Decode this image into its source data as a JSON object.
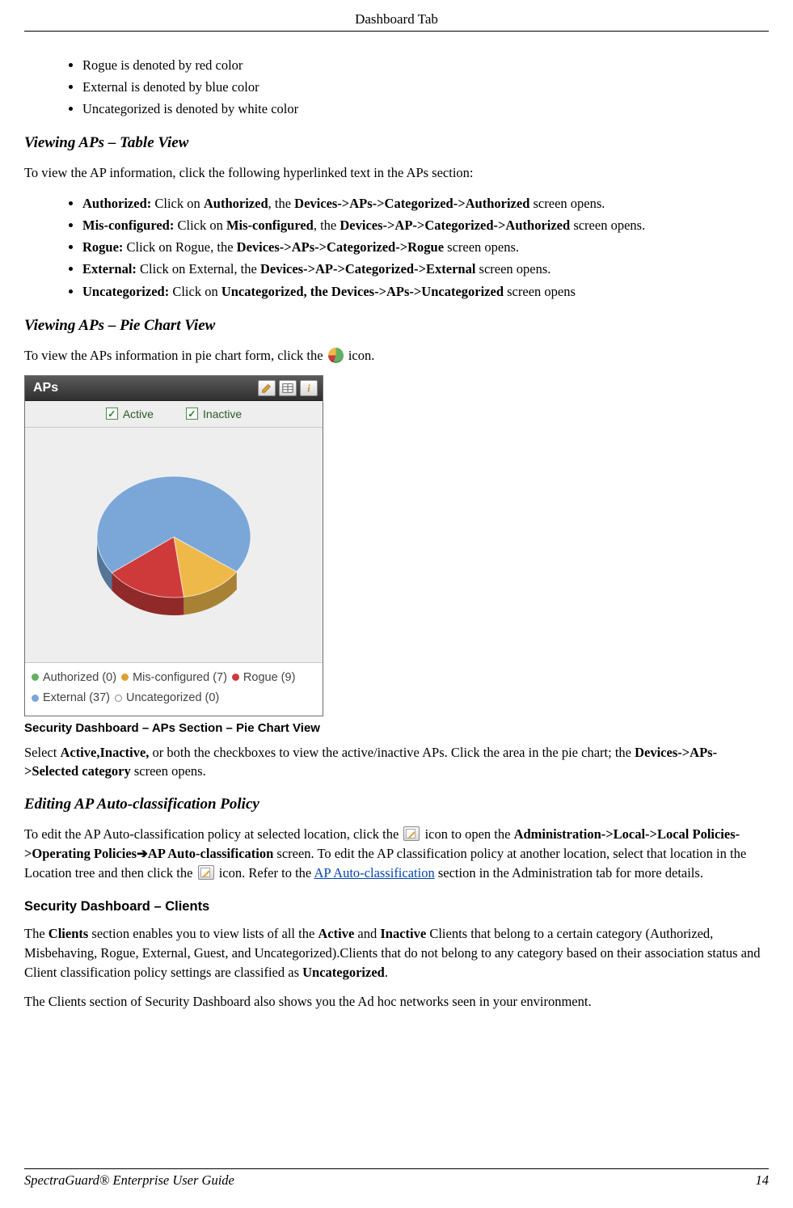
{
  "header": "Dashboard Tab",
  "color_bullets": [
    "Rogue is denoted by red color",
    "External is denoted by blue color",
    "Uncategorized is denoted by white color"
  ],
  "sections": {
    "table_view": {
      "heading": "Viewing APs – Table View",
      "intro": "To view the AP information, click the following hyperlinked text in the APs section:",
      "items": [
        {
          "label": "Authorized:",
          "rest_a": " Click on ",
          "b1": "Authorized",
          "rest_b": ", the ",
          "b2": "Devices->APs->Categorized->Authorized",
          "rest_c": " screen opens."
        },
        {
          "label": "Mis-configured:",
          "rest_a": " Click on ",
          "b1": "Mis-configured",
          "rest_b": ", the ",
          "b2": "Devices->AP->Categorized->Authorized",
          "rest_c": " screen opens."
        },
        {
          "label": "Rogue:",
          "rest_a": " Click on Rogue, the ",
          "b1": "",
          "rest_b": "",
          "b2": "Devices->APs->Categorized->Rogue",
          "rest_c": " screen opens."
        },
        {
          "label": "External:",
          "rest_a": " Click on External, the ",
          "b1": "",
          "rest_b": "",
          "b2": "Devices->AP->Categorized->External",
          "rest_c": " screen opens."
        },
        {
          "label": "Uncategorized:",
          "rest_a": " Click on ",
          "b1": "Uncategorized, the Devices->APs->Uncategorized",
          "rest_b": "",
          "b2": "",
          "rest_c": " screen opens"
        }
      ]
    },
    "pie_view": {
      "heading": "Viewing APs – Pie Chart View",
      "intro_a": "To view the APs information in pie chart form, click the ",
      "intro_b": " icon."
    },
    "caption": "Security Dashboard – APs Section – Pie Chart View",
    "pie_below_a": "Select ",
    "pie_below_bold1": "Active,Inactive,",
    "pie_below_mid": " or both the checkboxes to view the active/inactive APs. Click the area in the pie chart; the ",
    "pie_below_bold2": "Devices->APs->Selected category",
    "pie_below_end": " screen opens.",
    "edit_policy": {
      "heading": "Editing AP Auto-classification Policy",
      "p1a": "To edit the AP Auto-classification policy at selected location, click the ",
      "p1b": " icon to open the ",
      "p1_bold1": "Administration->Local->Local Policies->Operating Policies",
      "arrow": "➔",
      "p1_bold2": "AP Auto-classification",
      "p1c": " screen. To edit the AP classification policy at another location, select that location in the Location tree and then click the ",
      "p1d": " icon. Refer to the ",
      "link": "AP Auto-classification",
      "p1e": " section in the Administration tab for more details."
    },
    "clients": {
      "heading": "Security Dashboard – Clients",
      "p1a": "The ",
      "p1_b1": "Clients",
      "p1b": " section enables you to view lists of all the ",
      "p1_b2": "Active",
      "p1c": " and ",
      "p1_b3": "Inactive",
      "p1d": " Clients that belong to a certain category (Authorized, Misbehaving, Rogue, External, Guest, and Uncategorized).Clients that do not belong to any category based on their association status and Client classification policy settings are classified as ",
      "p1_b4": "Uncategorized",
      "p1e": ".",
      "p2": "The Clients section of Security Dashboard also shows you the Ad hoc networks seen in your environment."
    }
  },
  "aps_widget": {
    "title": "APs",
    "active_label": "Active",
    "inactive_label": "Inactive",
    "legend": [
      {
        "name": "Authorized",
        "count": 0,
        "color": "d-green"
      },
      {
        "name": "Mis-configured",
        "count": 7,
        "color": "d-orange"
      },
      {
        "name": "Rogue",
        "count": 9,
        "color": "d-red"
      },
      {
        "name": "External",
        "count": 37,
        "color": "d-blue"
      },
      {
        "name": "Uncategorized",
        "count": 0,
        "color": "d-white"
      }
    ]
  },
  "chart_data": {
    "type": "pie",
    "title": "APs",
    "series": [
      {
        "name": "Authorized",
        "value": 0,
        "color": "#62b060"
      },
      {
        "name": "Mis-configured",
        "value": 7,
        "color": "#efb94a"
      },
      {
        "name": "Rogue",
        "value": 9,
        "color": "#ce3a3a"
      },
      {
        "name": "External",
        "value": 37,
        "color": "#7aa7d8"
      },
      {
        "name": "Uncategorized",
        "value": 0,
        "color": "#ffffff"
      }
    ],
    "filters": {
      "Active": true,
      "Inactive": true
    }
  },
  "footer": {
    "title": "SpectraGuard®  Enterprise User Guide",
    "page": "14"
  }
}
